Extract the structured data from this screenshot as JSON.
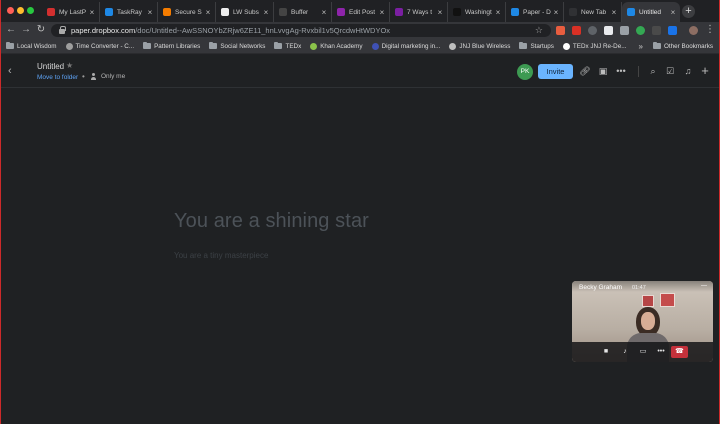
{
  "browser": {
    "tabs": [
      {
        "title": "My LastP",
        "color": "#d32f2f",
        "active": false
      },
      {
        "title": "TaskRay",
        "color": "#1e88e5",
        "active": false
      },
      {
        "title": "Secure S",
        "color": "#f57c00",
        "active": false
      },
      {
        "title": "LW Subs",
        "color": "#eeeeee",
        "active": false
      },
      {
        "title": "Buffer",
        "color": "#444444",
        "active": false
      },
      {
        "title": "Edit Post",
        "color": "#8e24aa",
        "active": false
      },
      {
        "title": "7 Ways t",
        "color": "#7b1fa2",
        "active": false
      },
      {
        "title": "Washingt",
        "color": "#111111",
        "active": false
      },
      {
        "title": "Paper - D",
        "color": "#1e88e5",
        "active": false
      },
      {
        "title": "New Tab",
        "color": "#303134",
        "active": false
      },
      {
        "title": "Untitled",
        "color": "#1e88e5",
        "active": true
      }
    ],
    "new_tab_label": "+",
    "url_host": "paper.dropbox.com",
    "url_path": "/doc/Untitled--AwSSNOYbZRjw6ZE11_hnLvvgAg-Rvxbil1v5QrcdwHtWDYOx",
    "bookmarks": [
      {
        "label": "Local Wisdom",
        "type": "folder"
      },
      {
        "label": "Time Converter - C...",
        "type": "icon",
        "color": "#9e9e9e"
      },
      {
        "label": "Pattern Libraries",
        "type": "folder"
      },
      {
        "label": "Social Networks",
        "type": "folder"
      },
      {
        "label": "TEDx",
        "type": "folder"
      },
      {
        "label": "Khan Academy",
        "type": "icon",
        "color": "#8bc34a"
      },
      {
        "label": "Digital marketing in...",
        "type": "icon",
        "color": "#3f51b5"
      },
      {
        "label": "JNJ Blue Wireless",
        "type": "icon",
        "color": "#bdbdbd"
      },
      {
        "label": "Startups",
        "type": "folder"
      },
      {
        "label": "TEDx JNJ Re-De...",
        "type": "icon",
        "color": "#ffffff"
      }
    ],
    "bookmarks_overflow": "»",
    "other_bookmarks": "Other Bookmarks"
  },
  "doc": {
    "title": "Untitled",
    "move_to_folder": "Move to folder",
    "separator": "•",
    "sharing": "Only me",
    "avatar_initials": "PK",
    "invite_label": "Invite",
    "heading": "You are a shining star",
    "subheading": "You are a tiny masterpiece"
  },
  "call": {
    "caller_name": "Becky Graham",
    "duration": "01:47"
  },
  "colors": {
    "invite": "#6ab4ff",
    "avatar": "#3d9a52",
    "hangup": "#c4313b",
    "link": "#5ea3f5"
  }
}
